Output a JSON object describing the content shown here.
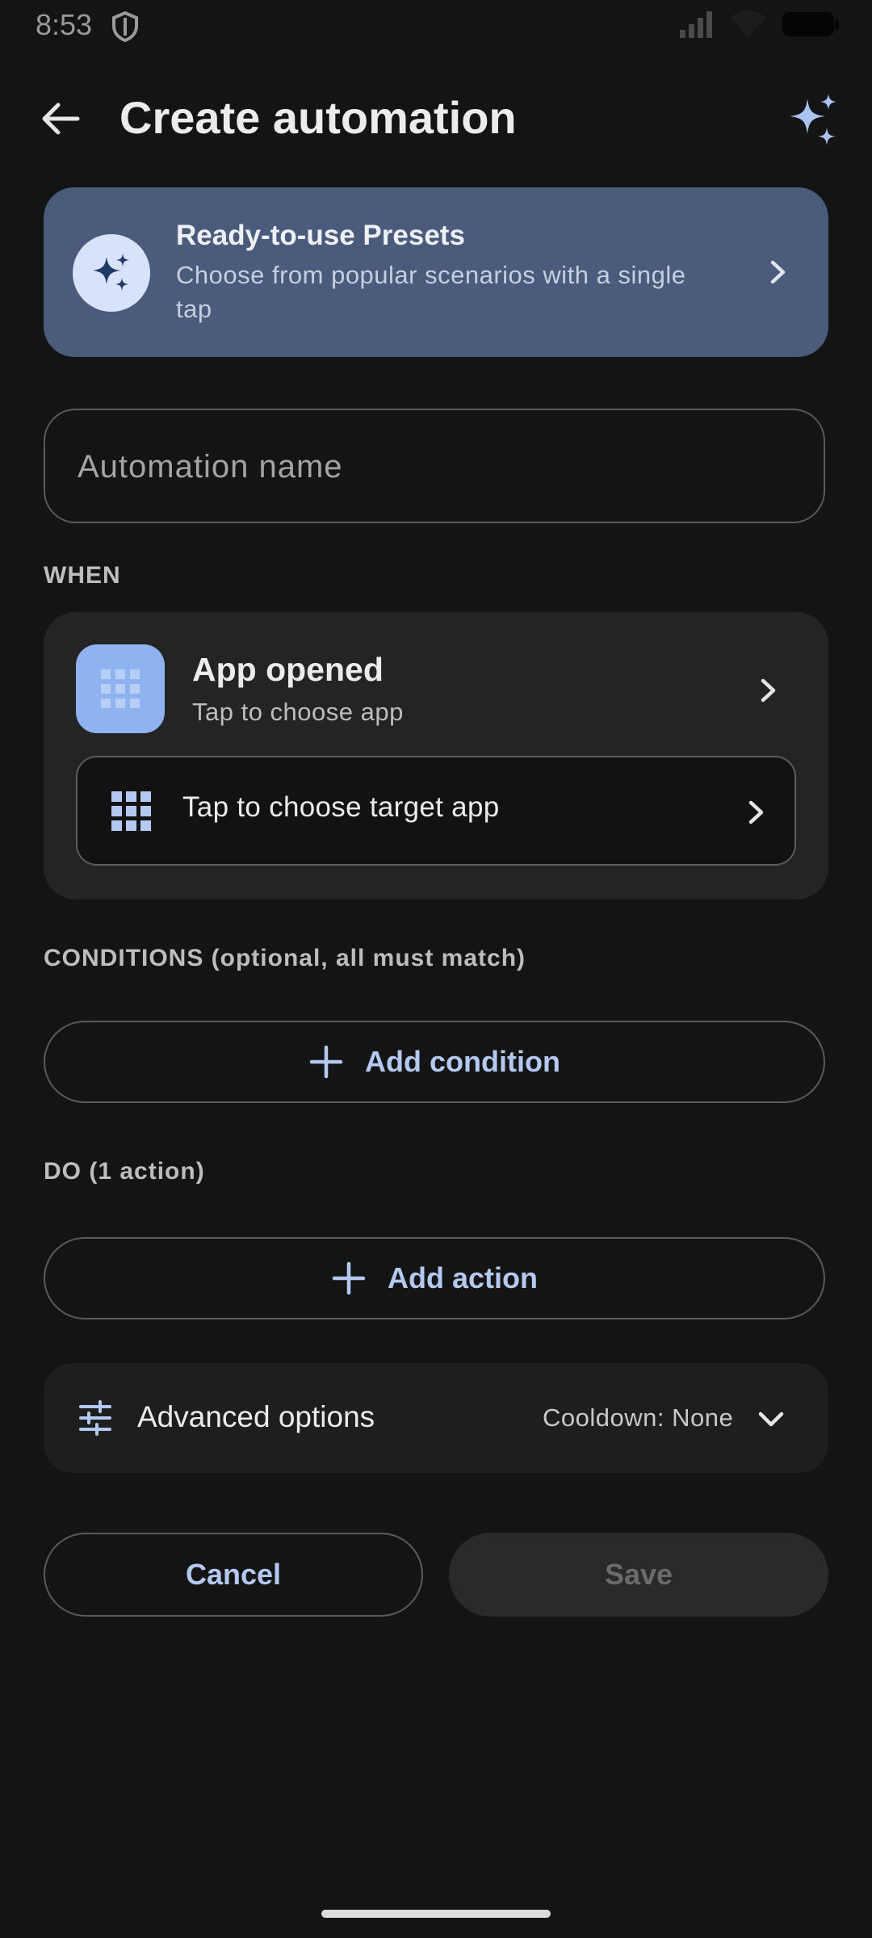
{
  "status_bar": {
    "time": "8:53"
  },
  "header": {
    "title": "Create automation"
  },
  "presets": {
    "title": "Ready-to-use Presets",
    "subtitle": "Choose from popular scenarios with a single tap"
  },
  "name_field": {
    "placeholder": "Automation name",
    "value": ""
  },
  "when": {
    "label": "WHEN",
    "trigger_title": "App opened",
    "trigger_subtitle": "Tap to choose app",
    "target_label": "Tap to choose target app"
  },
  "conditions": {
    "label": "CONDITIONS (optional, all must match)",
    "add_label": "Add condition"
  },
  "actions": {
    "label": "DO (1 action)",
    "add_label": "Add action"
  },
  "advanced": {
    "label": "Advanced options",
    "value": "Cooldown: None"
  },
  "footer": {
    "cancel_label": "Cancel",
    "save_label": "Save"
  },
  "colors": {
    "background": "#141414",
    "accent": "#b4c9f2",
    "presets_card": "#4a5b7b",
    "trigger_icon_bg": "#8fb3f0"
  },
  "icons": [
    "shield-icon",
    "signal-icon",
    "wifi-icon",
    "battery-icon",
    "back-arrow-icon",
    "sparkles-icon",
    "chevron-right-icon",
    "app-grid-icon",
    "plus-icon",
    "tune-icon",
    "chevron-down-icon"
  ]
}
